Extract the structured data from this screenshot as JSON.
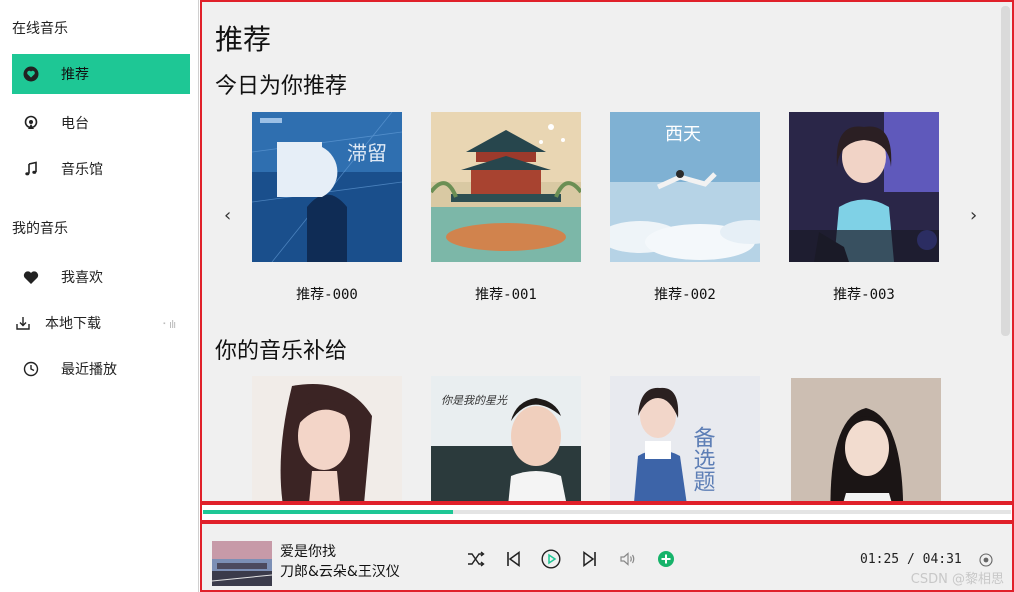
{
  "sidebar": {
    "online_title": "在线音乐",
    "my_title": "我的音乐",
    "online_items": [
      {
        "label": "推荐",
        "icon": "heart-circle-icon"
      },
      {
        "label": "电台",
        "icon": "radio-icon"
      },
      {
        "label": "音乐馆",
        "icon": "music-note-icon"
      }
    ],
    "my_items": [
      {
        "label": "我喜欢",
        "icon": "heart-icon"
      },
      {
        "label": "本地下载",
        "icon": "download-icon"
      },
      {
        "label": "最近播放",
        "icon": "clock-icon"
      }
    ]
  },
  "main": {
    "page_title": "推荐",
    "section_today": "今日为你推荐",
    "section_supply": "你的音乐补给",
    "recommend_cards": [
      {
        "label": "推荐-000",
        "cover_text": "滞留"
      },
      {
        "label": "推荐-001",
        "cover_text": ""
      },
      {
        "label": "推荐-002",
        "cover_text": "西天"
      },
      {
        "label": "推荐-003",
        "cover_text": ""
      }
    ],
    "supply_cards": [
      {
        "cover_text": ""
      },
      {
        "cover_text": "你是我的星光"
      },
      {
        "cover_text": "备选题"
      },
      {
        "cover_text": ""
      }
    ]
  },
  "player": {
    "song_title": "爱是你找",
    "artist": "刀郎&云朵&王汉仪",
    "current_time": "01:25",
    "total_time": "04:31",
    "time_display": "01:25 / 04:31",
    "progress": 0.31
  },
  "watermark": "CSDN @黎相思",
  "colors": {
    "accent": "#1ec795",
    "border_highlight": "#e0202a",
    "add_button": "#16b36a"
  }
}
